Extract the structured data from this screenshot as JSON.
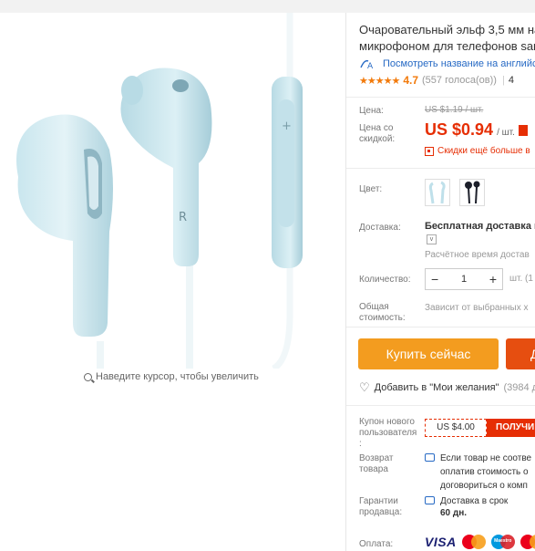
{
  "product": {
    "title_line1": "Очаровательный эльф 3,5 мм на",
    "title_line2": "микрофоном для телефонов sar",
    "translate_link": "Посмотреть название на английс",
    "rating": {
      "stars": "★★★★★",
      "score": "4.7",
      "votes": "(557 голоса(ов))",
      "cut": "4"
    }
  },
  "zoom_hint": "Наведите курсор, чтобы увеличить",
  "pricing": {
    "price_label": "Цена:",
    "old_price": "US $1.19 / шт.",
    "discount_label_1": "Цена со",
    "discount_label_2": "скидкой:",
    "new_price": "US $0.94",
    "unit": "/ шт.",
    "discount_text": "Скидки ещё больше в"
  },
  "options": {
    "color_label": "Цвет:",
    "shipping_label": "Доставка:",
    "shipping_value": "Бесплатная доставка в",
    "shipping_dropdown": "v",
    "shipping_estimate": "Расчётное время достав",
    "quantity_label": "Количество:",
    "qty_minus": "−",
    "qty_value": "1",
    "qty_plus": "+",
    "qty_after": "шт. (1",
    "total_label_1": "Общая",
    "total_label_2": "стоимость:",
    "total_value": "Зависит от выбранных х"
  },
  "actions": {
    "buy_now": "Купить сейчас",
    "second_button": "Д",
    "wishlist": "Добавить в \"Мои желания\"",
    "wishlist_count": "(3984 до"
  },
  "coupon": {
    "label_1": "Купон нового",
    "label_2": "пользователя",
    "label_3": ":",
    "amount": "US $4.00",
    "get": "ПОЛУЧИ"
  },
  "returns": {
    "label_1": "Возврат",
    "label_2": "товара",
    "line1": "Если товар не соотве",
    "line2": "оплатив стоимость о",
    "line3": "договориться о комп"
  },
  "guarantee": {
    "label_1": "Гарантии",
    "label_2": "продавца:",
    "line1": "Доставка в срок",
    "days": "60 дн."
  },
  "payment": {
    "label": "Оплата:",
    "visa": "VISA",
    "maestro": "Maestro"
  },
  "colors": {
    "accent": "#e62e04",
    "buy": "#f39c1f",
    "link": "#2669c4",
    "star": "#f27a0b"
  }
}
